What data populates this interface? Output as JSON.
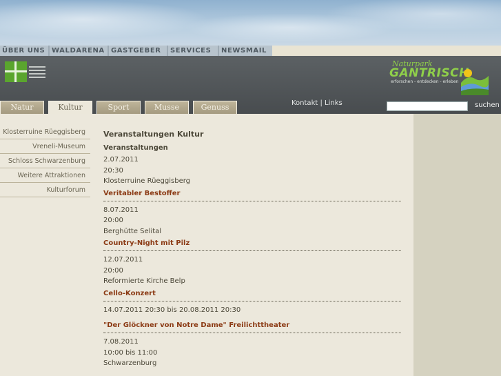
{
  "topnav": [
    "ÜBER UNS",
    "WALDARENA",
    "GASTGEBER",
    "SERVICES",
    "NEWSMAIL"
  ],
  "brand": {
    "subtitle": "Naturpark",
    "name": "GANTRISCH",
    "tagline": "erforschen - entdecken - erleben"
  },
  "tabs": [
    "Natur",
    "Kultur",
    "Sport",
    "Musse",
    "Genuss"
  ],
  "active_tab": "Kultur",
  "utility": {
    "kontakt": "Kontakt",
    "separator": "|",
    "links": "Links"
  },
  "search": {
    "value": "",
    "button": "suchen"
  },
  "subnav": [
    "Klosterruine Rüeggisberg",
    "Vreneli-Museum",
    "Schloss Schwarzenburg",
    "Weitere Attraktionen",
    "Kulturforum"
  ],
  "main": {
    "title": "Veranstaltungen Kultur",
    "subtitle": "Veranstaltungen",
    "events": [
      {
        "lines": [
          "2.07.2011",
          "20:30",
          "Klosterruine Rüeggisberg"
        ],
        "title": "Veritabler Bestoffer"
      },
      {
        "lines": [
          "8.07.2011",
          "20:00",
          "Berghütte Selital"
        ],
        "title": "Country-Night mit Pilz"
      },
      {
        "lines": [
          "12.07.2011",
          "20:00",
          "Reformierte Kirche Belp"
        ],
        "title": "Cello-Konzert"
      },
      {
        "lines": [
          "14.07.2011 20:30 bis 20.08.2011 20:30"
        ],
        "title": "\"Der Glöckner von Notre Dame\" Freilichttheater"
      },
      {
        "lines": [
          "7.08.2011",
          "10:00 bis 11:00",
          "Schwarzenburg"
        ],
        "title": ""
      }
    ]
  },
  "colors": {
    "event_title": "#8b3a14",
    "brand_green": "#8fcf4a",
    "band": "#4e5255"
  }
}
